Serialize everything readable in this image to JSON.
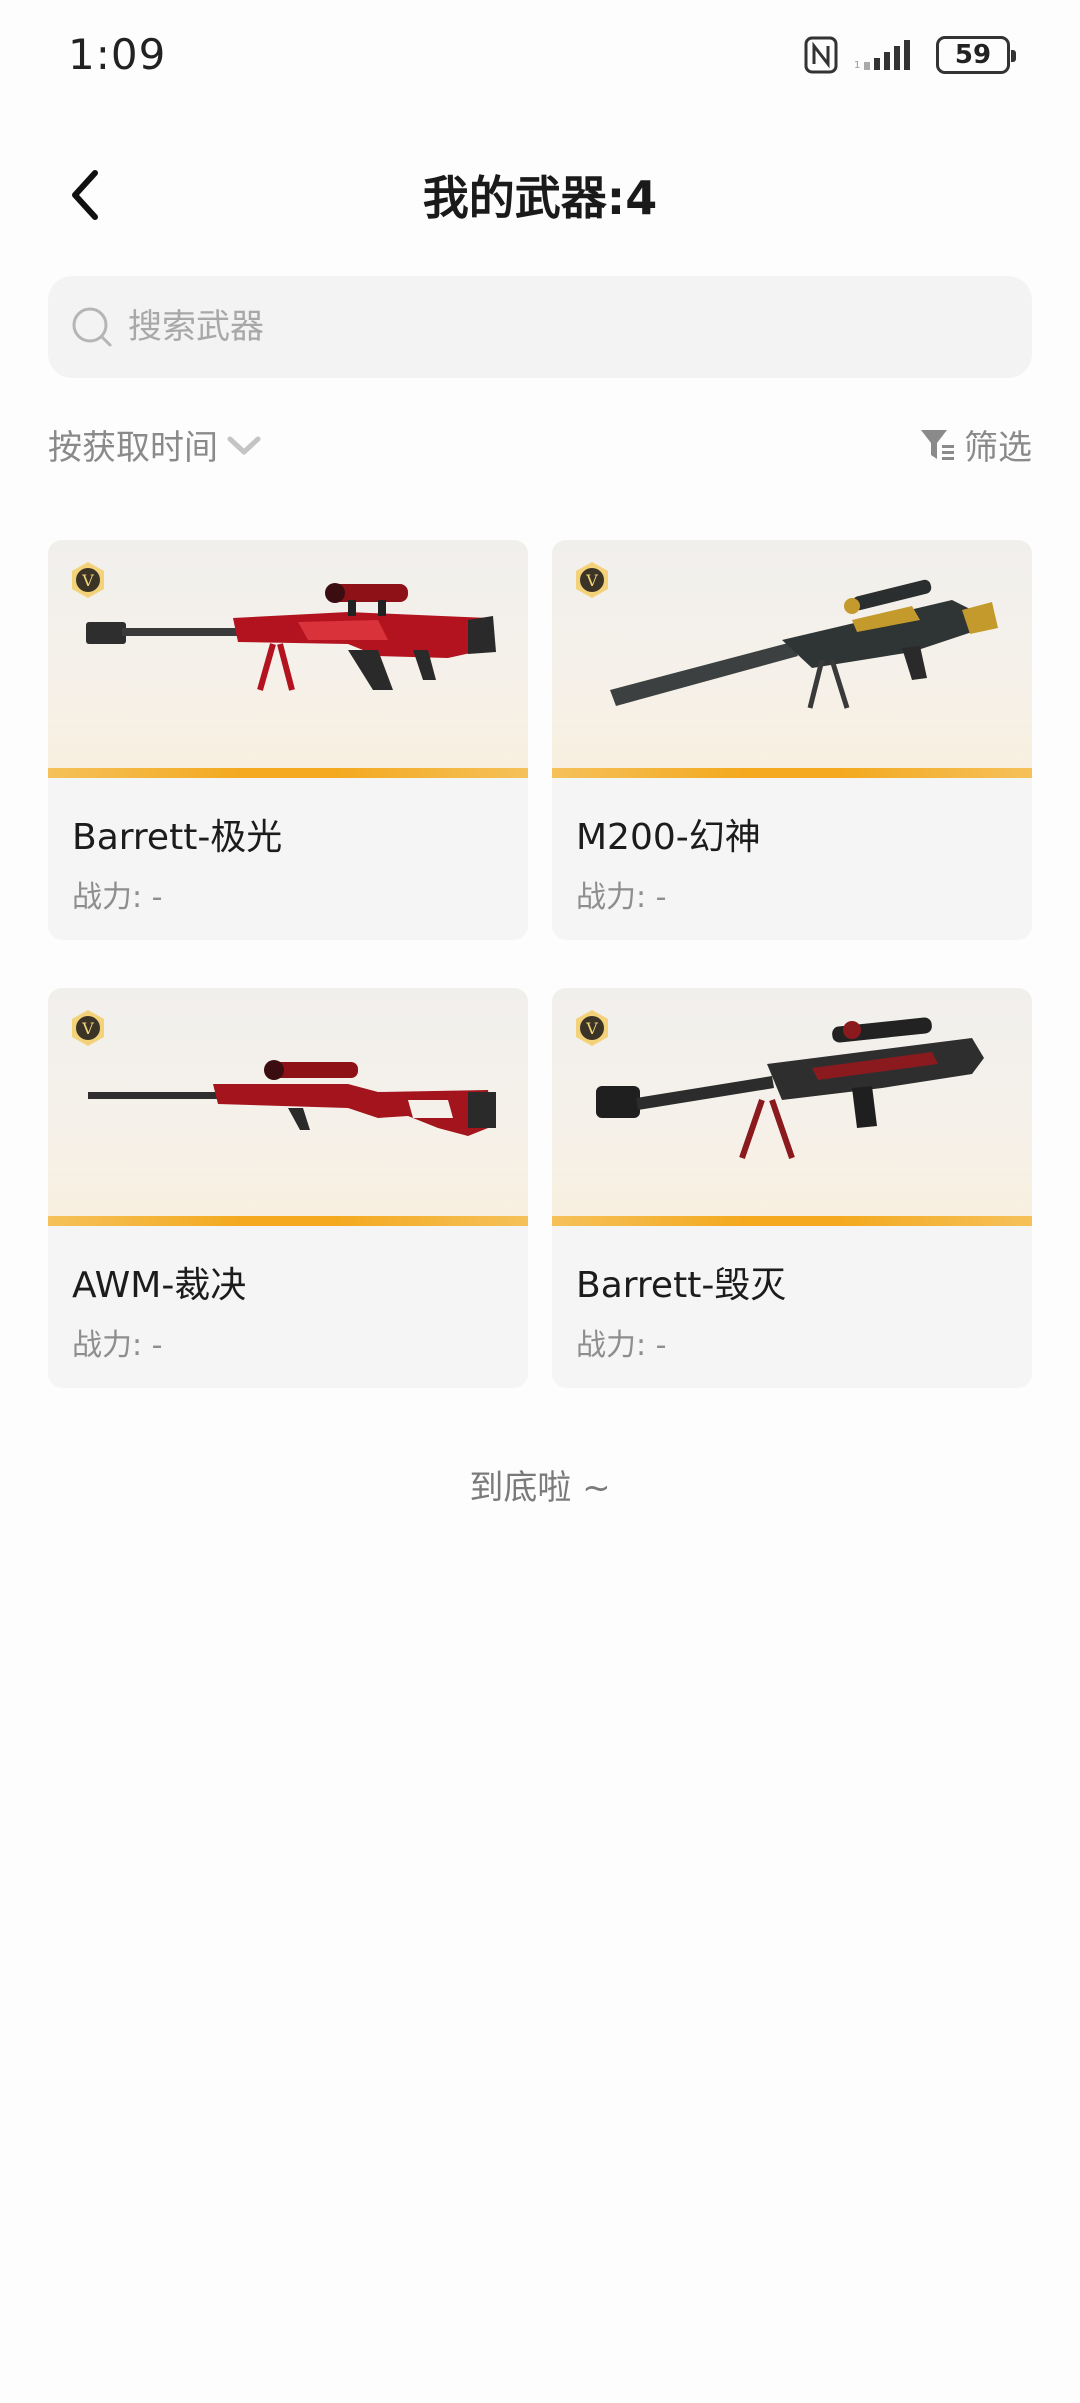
{
  "status": {
    "time": "1:09",
    "battery": "59",
    "signal_label": "4G"
  },
  "header": {
    "title": "我的武器:4"
  },
  "search": {
    "placeholder": "搜索武器",
    "value": ""
  },
  "sort": {
    "label": "按获取时间",
    "filter_label": "筛选"
  },
  "weapons": [
    {
      "name": "Barrett-极光",
      "power": "战力: -",
      "badge": "V",
      "icon": "rifle-red-icon"
    },
    {
      "name": "M200-幻神",
      "power": "战力: -",
      "badge": "V",
      "icon": "rifle-dark-gold-icon"
    },
    {
      "name": "AWM-裁决",
      "power": "战力: -",
      "badge": "V",
      "icon": "rifle-red-icon"
    },
    {
      "name": "Barrett-毁灭",
      "power": "战力: -",
      "badge": "V",
      "icon": "rifle-dark-red-icon"
    }
  ],
  "footer": {
    "end_text": "到底啦 ~"
  },
  "colors": {
    "accent_orange": "#f4a91f",
    "card_bg": "#f5f5f5",
    "search_bg": "#f3f3f3"
  }
}
